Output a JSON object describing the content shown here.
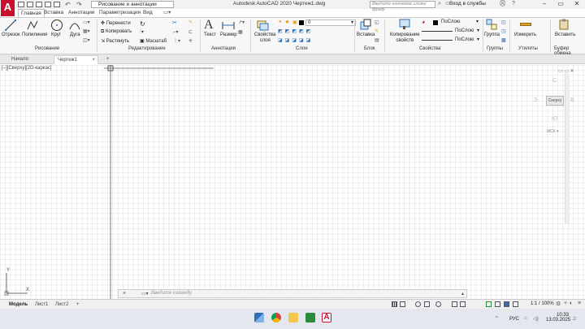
{
  "titlebar": {
    "workspace": "Рисование и аннотации",
    "app_title": "Autodesk AutoCAD 2020   Чертеж1.dwg",
    "search_placeholder": "Введите ключевое слово/фразу",
    "login": "Вход в службы"
  },
  "ribbon_tabs": [
    "Главная",
    "Вставка",
    "Аннотации",
    "Параметризация",
    "Вид"
  ],
  "ribbon": {
    "draw": {
      "line": "Отрезок",
      "polyline": "Полилиния",
      "circle": "Круг",
      "arc": "Дуга",
      "panel": "Рисование"
    },
    "modify": {
      "move": "Перенести",
      "copy": "Копировать",
      "stretch": "Растянуть",
      "scale": "Масштаб",
      "panel": "Редактирование"
    },
    "annot": {
      "text": "Текст",
      "dimension": "Размер",
      "panel": "Аннотации"
    },
    "layers": {
      "props": "Свойства слоя",
      "props_l1": "Свойства",
      "props_l2": "слоя",
      "current": "0",
      "panel": "Слои"
    },
    "block": {
      "insert": "Вставка",
      "panel": "Блок"
    },
    "properties": {
      "match_l1": "Копирование",
      "match_l2": "свойств",
      "bylayer1": "ПоСлою",
      "bylayer2": "ПоСлою",
      "bylayer3": "ПоСлою",
      "panel": "Свойства"
    },
    "groups": {
      "group": "Группа",
      "panel": "Группы"
    },
    "utils": {
      "measure": "Измерить",
      "panel": "Утилиты"
    },
    "clipboard": {
      "paste": "Вставить",
      "panel": "Буфер обмена"
    }
  },
  "file_tabs": {
    "start": "Начало",
    "drawing": "Чертеж1",
    "close": "×",
    "add": "+"
  },
  "viewport": {
    "label": "[–][Сверху][2D-каркас]",
    "cube_face": "Сверху",
    "dir_n": "С",
    "dir_s": "Ю",
    "dir_w": "З",
    "dir_e": "В",
    "wcs": "МСК",
    "ucs_x": "X",
    "ucs_y": "Y"
  },
  "command": {
    "placeholder": "Введите команду",
    "close": "×"
  },
  "layout_tabs": {
    "model": "Модель",
    "sheet1": "Лист1",
    "sheet2": "Лист2",
    "add": "+"
  },
  "status": {
    "scale": "1:1 / 100%"
  },
  "taskbar": {
    "lang": "РУС",
    "time": "10:33",
    "date": "13.03.2025"
  },
  "colors": {
    "accent": "#c8102e",
    "grid": "#d9dde3",
    "blue": "#2f6fba"
  }
}
